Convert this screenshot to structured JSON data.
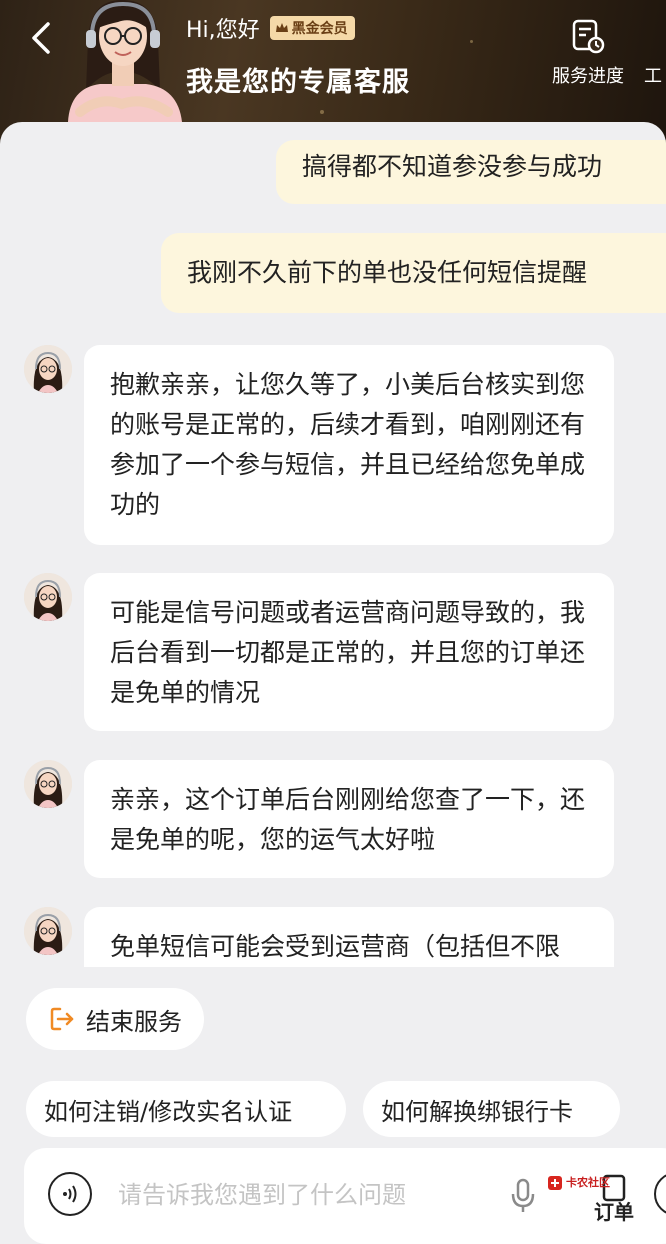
{
  "header": {
    "greeting": "Hi,您好",
    "member_badge": "黑金会员",
    "title": "我是您的专属客服",
    "service_progress": "服务进度",
    "ticket_partial": "工"
  },
  "messages": {
    "user_1": "搞得都不知道参没参与成功",
    "user_2": "我刚不久前下的单也没任何短信提醒",
    "agent_1": "抱歉亲亲，让您久等了，小美后台核实到您的账号是正常的，后续才看到，咱刚刚还有参加了一个参与短信，并且已经给您免单成功的",
    "agent_2": "可能是信号问题或者运营商问题导致的，我后台看到一切都是正常的，并且您的订单还是免单的情况",
    "agent_3": "亲亲，这个订单后台刚刚给您查了一下，还是免单的呢，您的运气太好啦",
    "agent_4": "免单短信可能会受到运营商（包括但不限"
  },
  "actions": {
    "end_service": "结束服务",
    "quick_1": "如何注销/修改实名认证",
    "quick_2": "如何解换绑银行卡"
  },
  "input": {
    "placeholder": "请告诉我您遇到了什么问题",
    "order_label": "订单",
    "watermark": "卡农社区"
  },
  "colors": {
    "header_bg": "#3a2a18",
    "badge_bg": "#f5d9a8",
    "user_bubble": "#fdf6dd",
    "agent_bubble": "#ffffff",
    "end_icon": "#f08a24"
  }
}
